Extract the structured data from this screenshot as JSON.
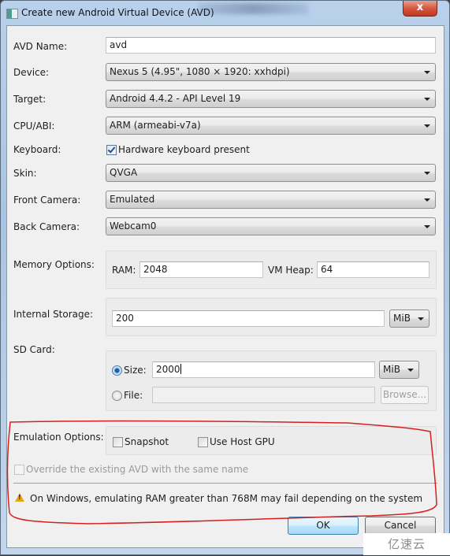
{
  "window": {
    "title": "Create new Android Virtual Device (AVD)",
    "close_glyph": "x"
  },
  "form": {
    "avd_name": {
      "label": "AVD Name:",
      "value": "avd"
    },
    "device": {
      "label": "Device:",
      "value": "Nexus 5 (4.95\", 1080 × 1920: xxhdpi)"
    },
    "target": {
      "label": "Target:",
      "value": "Android 4.4.2 - API Level 19"
    },
    "cpu_abi": {
      "label": "CPU/ABI:",
      "value": "ARM (armeabi-v7a)"
    },
    "keyboard": {
      "label": "Keyboard:",
      "checkbox_label": "Hardware keyboard present",
      "checked": true
    },
    "skin": {
      "label": "Skin:",
      "value": "QVGA"
    },
    "front_camera": {
      "label": "Front Camera:",
      "value": "Emulated"
    },
    "back_camera": {
      "label": "Back Camera:",
      "value": "Webcam0"
    },
    "memory": {
      "label": "Memory Options:",
      "ram_label": "RAM:",
      "ram_value": "2048",
      "vm_heap_label": "VM Heap:",
      "vm_heap_value": "64"
    },
    "internal_storage": {
      "label": "Internal Storage:",
      "value": "200",
      "unit": "MiB"
    },
    "sd_card": {
      "label": "SD Card:",
      "size_label": "Size:",
      "size_value": "2000",
      "size_unit": "MiB",
      "size_selected": true,
      "file_label": "File:",
      "file_value": "",
      "browse_label": "Browse..."
    },
    "emulation": {
      "label": "Emulation Options:",
      "snapshot_label": "Snapshot",
      "snapshot_checked": false,
      "host_gpu_label": "Use Host GPU",
      "host_gpu_checked": false
    },
    "override": {
      "label": "Override the existing AVD with the same name",
      "checked": false,
      "enabled": false
    }
  },
  "warning": {
    "icon": "warning-icon",
    "text": "On Windows, emulating RAM greater than 768M may fail depending on the system"
  },
  "buttons": {
    "ok": "OK",
    "cancel": "Cancel"
  },
  "annotation": {
    "color": "#d42020"
  },
  "watermark": {
    "text": "亿速云"
  }
}
